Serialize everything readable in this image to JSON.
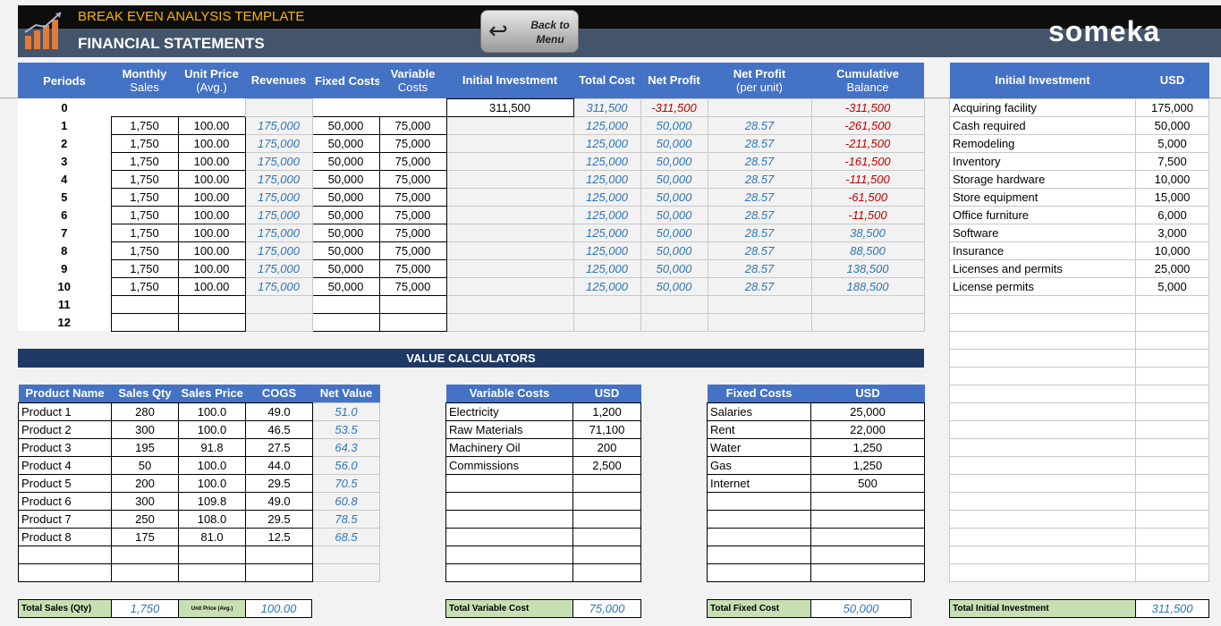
{
  "header": {
    "title": "BREAK EVEN ANALYSIS TEMPLATE",
    "subtitle": "FINANCIAL STATEMENTS",
    "back_label_1": "Back to",
    "back_label_2": "Menu",
    "brand": "someka"
  },
  "main": {
    "headers": [
      [
        "Periods",
        ""
      ],
      [
        "Monthly",
        "Sales"
      ],
      [
        "Unit Price",
        "(Avg.)"
      ],
      [
        "Revenues",
        ""
      ],
      [
        "Fixed Costs",
        ""
      ],
      [
        "Variable",
        "Costs"
      ],
      [
        "Initial Investment",
        ""
      ],
      [
        "Total Cost",
        ""
      ],
      [
        "Net Profit",
        ""
      ],
      [
        "Net Profit",
        "(per unit)"
      ],
      [
        "Cumulative",
        "Balance"
      ]
    ],
    "rows": [
      [
        "0",
        "",
        "",
        "",
        "",
        "",
        "311,500",
        "311,500",
        "-311,500",
        "",
        "-311,500"
      ],
      [
        "1",
        "1,750",
        "100.00",
        "175,000",
        "50,000",
        "75,000",
        "",
        "125,000",
        "50,000",
        "28.57",
        "-261,500"
      ],
      [
        "2",
        "1,750",
        "100.00",
        "175,000",
        "50,000",
        "75,000",
        "",
        "125,000",
        "50,000",
        "28.57",
        "-211,500"
      ],
      [
        "3",
        "1,750",
        "100.00",
        "175,000",
        "50,000",
        "75,000",
        "",
        "125,000",
        "50,000",
        "28.57",
        "-161,500"
      ],
      [
        "4",
        "1,750",
        "100.00",
        "175,000",
        "50,000",
        "75,000",
        "",
        "125,000",
        "50,000",
        "28.57",
        "-111,500"
      ],
      [
        "5",
        "1,750",
        "100.00",
        "175,000",
        "50,000",
        "75,000",
        "",
        "125,000",
        "50,000",
        "28.57",
        "-61,500"
      ],
      [
        "6",
        "1,750",
        "100.00",
        "175,000",
        "50,000",
        "75,000",
        "",
        "125,000",
        "50,000",
        "28.57",
        "-11,500"
      ],
      [
        "7",
        "1,750",
        "100.00",
        "175,000",
        "50,000",
        "75,000",
        "",
        "125,000",
        "50,000",
        "28.57",
        "38,500"
      ],
      [
        "8",
        "1,750",
        "100.00",
        "175,000",
        "50,000",
        "75,000",
        "",
        "125,000",
        "50,000",
        "28.57",
        "88,500"
      ],
      [
        "9",
        "1,750",
        "100.00",
        "175,000",
        "50,000",
        "75,000",
        "",
        "125,000",
        "50,000",
        "28.57",
        "138,500"
      ],
      [
        "10",
        "1,750",
        "100.00",
        "175,000",
        "50,000",
        "75,000",
        "",
        "125,000",
        "50,000",
        "28.57",
        "188,500"
      ],
      [
        "11",
        "",
        "",
        "",
        "",
        "",
        "",
        "",
        "",
        "",
        ""
      ],
      [
        "12",
        "",
        "",
        "",
        "",
        "",
        "",
        "",
        "",
        "",
        ""
      ]
    ]
  },
  "investment": {
    "header_name": "Initial Investment",
    "header_usd": "USD",
    "items": [
      [
        "Acquiring facility",
        "175,000"
      ],
      [
        "Cash required",
        "50,000"
      ],
      [
        "Remodeling",
        "5,000"
      ],
      [
        "Inventory",
        "7,500"
      ],
      [
        "Storage hardware",
        "10,000"
      ],
      [
        "Store equipment",
        "15,000"
      ],
      [
        "Office furniture",
        "6,000"
      ],
      [
        "Software",
        "3,000"
      ],
      [
        "Insurance",
        "10,000"
      ],
      [
        "Licenses and permits",
        "25,000"
      ],
      [
        "License permits",
        "5,000"
      ],
      [
        "",
        ""
      ],
      [
        "",
        ""
      ],
      [
        "",
        ""
      ],
      [
        "",
        ""
      ],
      [
        "",
        ""
      ],
      [
        "",
        ""
      ],
      [
        "",
        ""
      ],
      [
        "",
        ""
      ],
      [
        "",
        ""
      ],
      [
        "",
        ""
      ],
      [
        "",
        ""
      ],
      [
        "",
        ""
      ],
      [
        "",
        ""
      ],
      [
        "",
        ""
      ],
      [
        "",
        ""
      ],
      [
        "",
        ""
      ]
    ],
    "total_label": "Total Initial Investment",
    "total_value": "311,500"
  },
  "value_calculators": {
    "title": "VALUE CALCULATORS"
  },
  "products": {
    "headers": [
      "Product Name",
      "Sales Qty",
      "Sales Price",
      "COGS",
      "Net Value"
    ],
    "rows": [
      [
        "Product 1",
        "280",
        "100.0",
        "49.0",
        "51.0"
      ],
      [
        "Product 2",
        "300",
        "100.0",
        "46.5",
        "53.5"
      ],
      [
        "Product 3",
        "195",
        "91.8",
        "27.5",
        "64.3"
      ],
      [
        "Product 4",
        "50",
        "100.0",
        "44.0",
        "56.0"
      ],
      [
        "Product 5",
        "200",
        "100.0",
        "29.5",
        "70.5"
      ],
      [
        "Product 6",
        "300",
        "109.8",
        "49.0",
        "60.8"
      ],
      [
        "Product 7",
        "250",
        "108.0",
        "29.5",
        "78.5"
      ],
      [
        "Product 8",
        "175",
        "81.0",
        "12.5",
        "68.5"
      ],
      [
        "",
        "",
        "",
        "",
        ""
      ],
      [
        "",
        "",
        "",
        "",
        ""
      ]
    ],
    "total_sales_label": "Total Sales (Qty)",
    "total_sales_value": "1,750",
    "unit_price_label": "Unit Price (Avg.)",
    "unit_price_value": "100.00"
  },
  "variable_costs": {
    "headers": [
      "Variable Costs",
      "USD"
    ],
    "rows": [
      [
        "Electricity",
        "1,200"
      ],
      [
        "Raw Materials",
        "71,100"
      ],
      [
        "Machinery Oil",
        "200"
      ],
      [
        "Commissions",
        "2,500"
      ],
      [
        "",
        ""
      ],
      [
        "",
        ""
      ],
      [
        "",
        ""
      ],
      [
        "",
        ""
      ],
      [
        "",
        ""
      ],
      [
        "",
        ""
      ]
    ],
    "total_label": "Total Variable Cost",
    "total_value": "75,000"
  },
  "fixed_costs": {
    "headers": [
      "Fixed Costs",
      "USD"
    ],
    "rows": [
      [
        "Salaries",
        "25,000"
      ],
      [
        "Rent",
        "22,000"
      ],
      [
        "Water",
        "1,250"
      ],
      [
        "Gas",
        "1,250"
      ],
      [
        "Internet",
        "500"
      ],
      [
        "",
        ""
      ],
      [
        "",
        ""
      ],
      [
        "",
        ""
      ],
      [
        "",
        ""
      ],
      [
        "",
        ""
      ]
    ],
    "total_label": "Total Fixed Cost",
    "total_value": "50,000"
  },
  "colors": {
    "header_blue": "#4472c4",
    "dark_navy": "#1f3864",
    "total_green": "#c6e0b4",
    "accent_orange": "#f5b400",
    "value_blue": "#2f75b5",
    "negative_red": "#c00000"
  }
}
